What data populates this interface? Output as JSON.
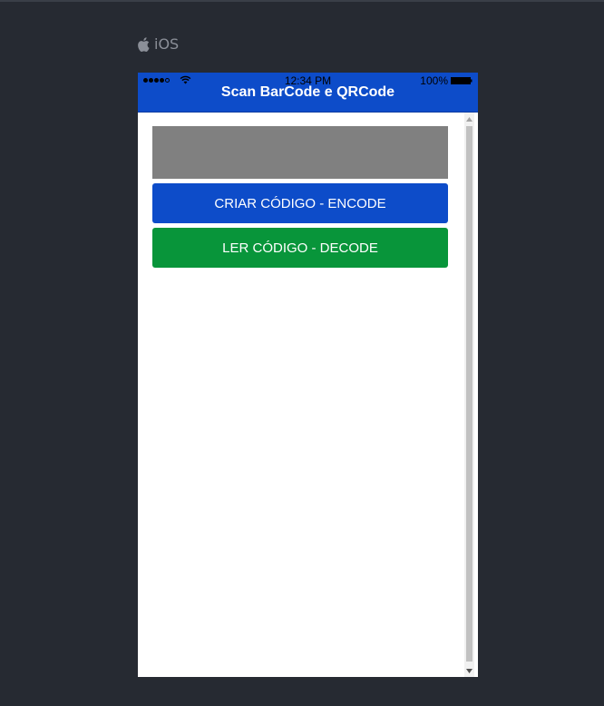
{
  "platform": {
    "icon": "apple-icon",
    "label": "iOS"
  },
  "statusbar": {
    "time": "12:34 PM",
    "battery": "100%"
  },
  "navbar": {
    "title": "Scan BarCode e QRCode",
    "background": "#0d4cc9"
  },
  "buttons": {
    "encode": {
      "label": "CRIAR CÓDIGO - ENCODE",
      "color": "#0d4cc9"
    },
    "decode": {
      "label": "LER CÓDIGO - DECODE",
      "color": "#08953a"
    }
  },
  "placeholder": {
    "color": "#808080"
  }
}
